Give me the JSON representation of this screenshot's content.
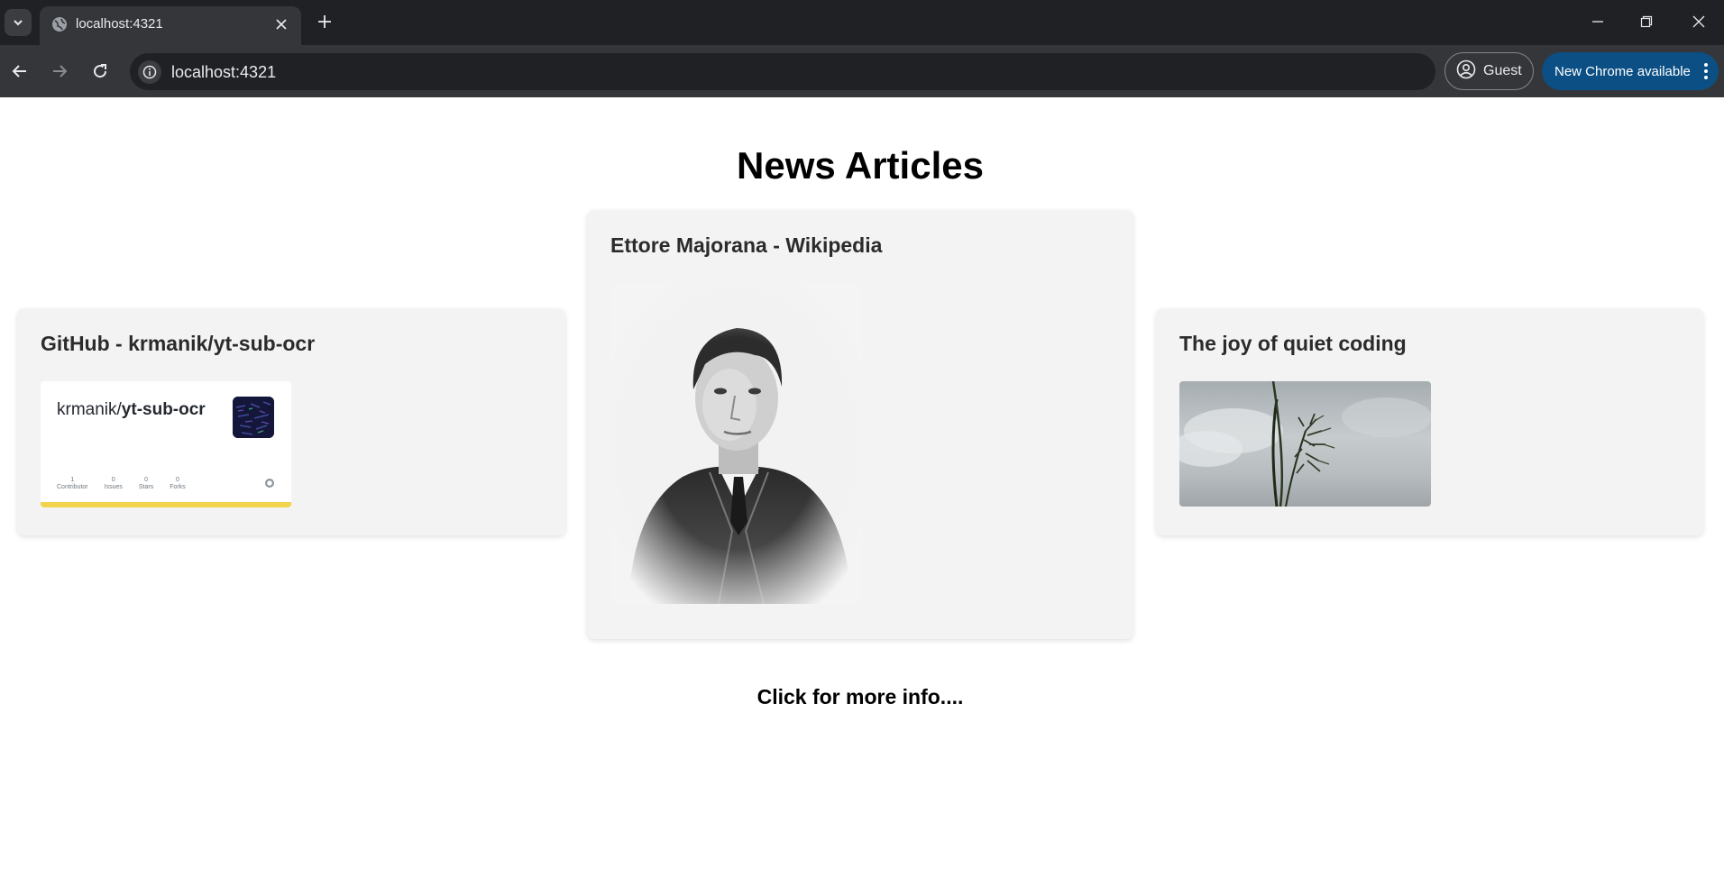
{
  "browser": {
    "tab_title": "localhost:4321",
    "url": "localhost:4321",
    "profile_label": "Guest",
    "update_label": "New Chrome available",
    "icons": [
      "tab-search-icon",
      "globe-icon",
      "close-icon",
      "plus-icon",
      "minimize-icon",
      "restore-icon",
      "window-close-icon",
      "back-icon",
      "forward-icon",
      "reload-icon",
      "site-info-icon",
      "profile-icon",
      "more-vert-icon"
    ]
  },
  "page": {
    "title": "News Articles",
    "footer_link": "Click for more info....",
    "articles": [
      {
        "title": "GitHub - krmanik/yt-sub-ocr",
        "preview": {
          "owner": "krmanik/",
          "repo": "yt-sub-ocr",
          "stats": [
            {
              "value": "1",
              "label": "Contributor"
            },
            {
              "value": "0",
              "label": "Issues"
            },
            {
              "value": "0",
              "label": "Stars"
            },
            {
              "value": "0",
              "label": "Forks"
            }
          ],
          "accent_color": "#f1d44b"
        }
      },
      {
        "title": "Ettore Majorana - Wikipedia",
        "image": "black-and-white portrait photograph"
      },
      {
        "title": "The joy of quiet coding",
        "image": "grass stalk against grey sky"
      }
    ]
  }
}
